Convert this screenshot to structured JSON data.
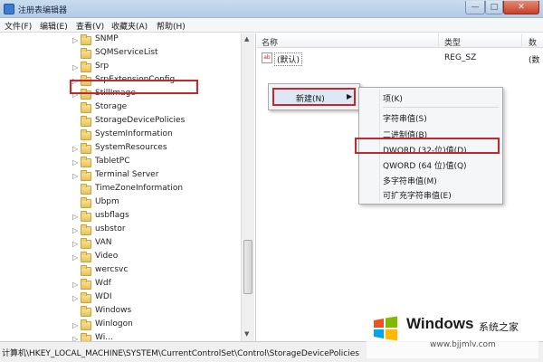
{
  "window": {
    "title": "注册表编辑器",
    "minimize": "—",
    "maximize": "□",
    "close": "✕"
  },
  "menubar": [
    "文件(F)",
    "编辑(E)",
    "查看(V)",
    "收藏夹(A)",
    "帮助(H)"
  ],
  "tree": {
    "items": [
      "SNMP",
      "SQMServiceList",
      "Srp",
      "SrpExtensionConfig",
      "StillImage",
      "Storage",
      "StorageDevicePolicies",
      "SystemInformation",
      "SystemResources",
      "TabletPC",
      "Terminal Server",
      "TimeZoneInformation",
      "Ubpm",
      "usbflags",
      "usbstor",
      "VAN",
      "Video",
      "wercsvc",
      "Wdf",
      "WDI",
      "Windows",
      "Winlogon",
      "Wi..."
    ],
    "highlighted": "StorageDevicePolicies"
  },
  "list": {
    "columns": [
      "名称",
      "类型",
      "数"
    ],
    "rows": [
      {
        "name": "(默认)",
        "type": "REG_SZ",
        "data": "(数"
      }
    ]
  },
  "context_menu": {
    "new_label": "新建(N)",
    "submenu": {
      "key": "项(K)",
      "items": [
        "字符串值(S)",
        "二进制值(B)",
        "DWORD (32-位)值(D)",
        "QWORD (64 位)值(Q)",
        "多字符串值(M)",
        "可扩充字符串值(E)"
      ],
      "highlighted": "DWORD (32-位)值(D)"
    }
  },
  "statusbar": {
    "path": "计算机\\HKEY_LOCAL_MACHINE\\SYSTEM\\CurrentControlSet\\Control\\StorageDevicePolicies"
  },
  "watermark": {
    "brand": "Windows",
    "subtitle": "系统之家",
    "url": "www.bjjmlv.com"
  },
  "colors": {
    "highlight_border": "#c8262d",
    "folder": "#e8c25a"
  }
}
